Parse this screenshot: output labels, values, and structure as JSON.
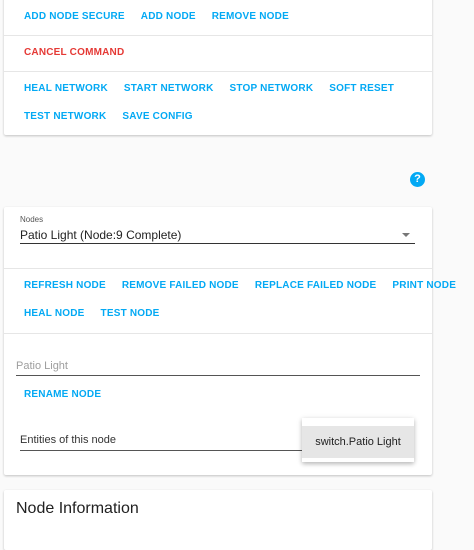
{
  "network_actions": {
    "row1": [
      "ADD NODE SECURE",
      "ADD NODE",
      "REMOVE NODE"
    ],
    "cancel": "CANCEL COMMAND",
    "row3": [
      "HEAL NETWORK",
      "START NETWORK",
      "STOP NETWORK",
      "SOFT RESET"
    ],
    "row4": [
      "TEST NETWORK",
      "SAVE CONFIG"
    ]
  },
  "help_icon_glyph": "?",
  "node_select": {
    "label": "Nodes",
    "value": "Patio Light (Node:9 Complete)"
  },
  "node_actions": {
    "row1": [
      "REFRESH NODE",
      "REMOVE FAILED NODE",
      "REPLACE FAILED NODE",
      "PRINT NODE"
    ],
    "row2": [
      "HEAL NODE",
      "TEST NODE"
    ]
  },
  "rename": {
    "placeholder": "Patio Light",
    "button": "RENAME NODE"
  },
  "entities": {
    "label": "Entities of this node",
    "selected": "switch.Patio Light"
  },
  "node_information": {
    "title": "Node Information"
  },
  "colors": {
    "accent": "#03a9f4",
    "danger": "#e53935"
  }
}
